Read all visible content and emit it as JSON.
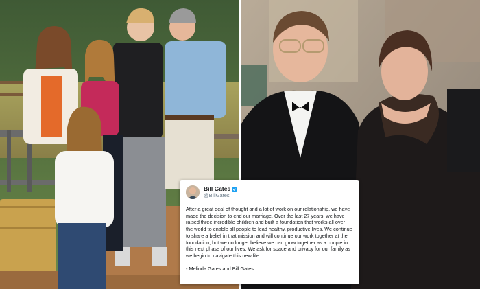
{
  "left_photo": {
    "description_icon": "family-photo"
  },
  "right_photo": {
    "description_icon": "couple-photo"
  },
  "tweet": {
    "name": "Bill Gates",
    "handle": "@BillGates",
    "verified_icon": "verified-badge-icon",
    "body": "After a great deal of thought and a lot of work on our relationship, we have made the decision to end our marriage. Over the last 27 years, we have raised three incredible children and built a foundation that works all over the world to enable all people to lead healthy, productive lives. We continue to share a belief in that mission and will continue our work together at the foundation, but we no longer believe we can grow together as a couple in this next phase of our lives. We ask for space and privacy for our family as we begin to navigate this new life.",
    "signature": "- Melinda Gates and Bill Gates"
  },
  "colors": {
    "twitter_blue": "#1da1f2",
    "handle_gray": "#657786"
  }
}
